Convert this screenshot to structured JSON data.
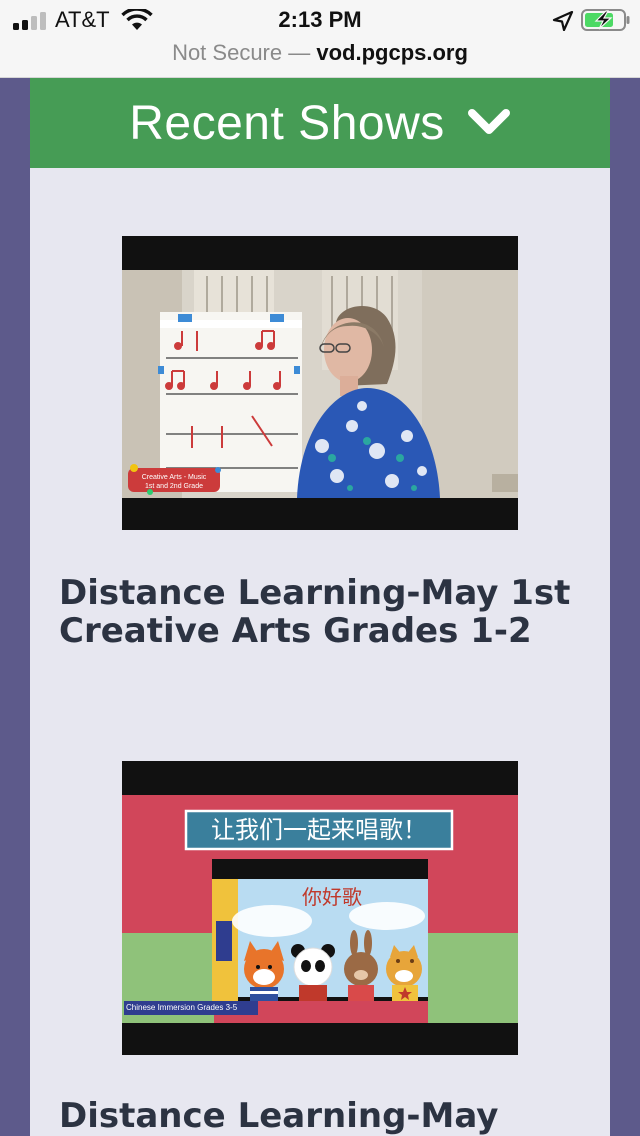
{
  "status_bar": {
    "carrier": "AT&T",
    "time": "2:13 PM"
  },
  "url_bar": {
    "security": "Not Secure",
    "separator": "—",
    "host": "vod.pgcps.org"
  },
  "section": {
    "title": "Recent Shows"
  },
  "shows": [
    {
      "title": "Distance Learning-May 1st Creative Arts Grades 1-2",
      "thumbnail_caption_line1": "Creative Arts - Music",
      "thumbnail_caption_line2": "1st and 2nd Grade"
    },
    {
      "title": "Distance Learning-May",
      "thumbnail_banner": "让我们一起来唱歌！",
      "thumbnail_song_title": "你好歌",
      "thumbnail_caption": "Chinese Immersion Grades 3-5"
    }
  ],
  "colors": {
    "header_green": "#469c55",
    "page_side": "#5d5a8b",
    "panel_bg": "#e7e7f0",
    "title_text": "#2c3342"
  }
}
